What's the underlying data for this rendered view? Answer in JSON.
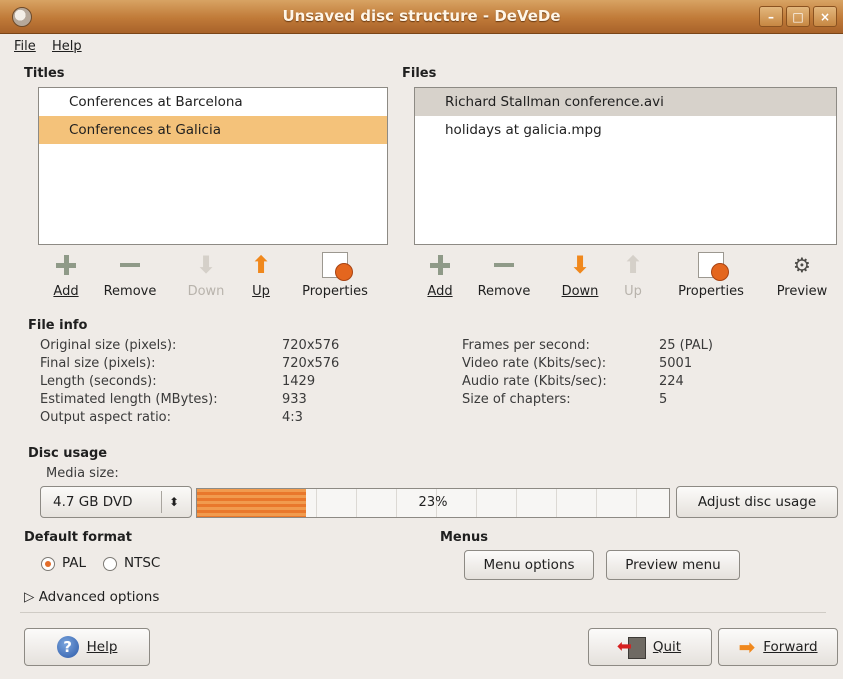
{
  "window": {
    "title": "Unsaved disc structure - DeVeDe",
    "controls": [
      "–",
      "□",
      "×"
    ]
  },
  "menubar": {
    "file": "File",
    "help": "Help"
  },
  "titles": {
    "label": "Titles",
    "items": [
      "Conferences at Barcelona",
      "Conferences at Galicia"
    ],
    "selected_index": 1,
    "toolbar": {
      "add": "Add",
      "remove": "Remove",
      "down": "Down",
      "up": "Up",
      "properties": "Properties"
    }
  },
  "files": {
    "label": "Files",
    "items": [
      "Richard Stallman conference.avi",
      "holidays at galicia.mpg"
    ],
    "selected_index": 0,
    "toolbar": {
      "add": "Add",
      "remove": "Remove",
      "down": "Down",
      "up": "Up",
      "properties": "Properties",
      "preview": "Preview"
    }
  },
  "file_info": {
    "label": "File info",
    "left": [
      {
        "label": "Original size (pixels):",
        "value": "720x576"
      },
      {
        "label": "Final size (pixels):",
        "value": "720x576"
      },
      {
        "label": "Length (seconds):",
        "value": "1429"
      },
      {
        "label": "Estimated length (MBytes):",
        "value": "933"
      },
      {
        "label": "Output aspect ratio:",
        "value": "4:3"
      }
    ],
    "right": [
      {
        "label": "Frames per second:",
        "value": "25 (PAL)"
      },
      {
        "label": "Video rate (Kbits/sec):",
        "value": "5001"
      },
      {
        "label": "Audio rate (Kbits/sec):",
        "value": "224"
      },
      {
        "label": "Size of chapters:",
        "value": "5"
      }
    ]
  },
  "disc_usage": {
    "label": "Disc usage",
    "media_label": "Media size:",
    "media_value": "4.7 GB DVD",
    "progress_text": "23%",
    "progress_fraction": 0.23,
    "adjust_button": "Adjust disc usage"
  },
  "default_format": {
    "label": "Default format",
    "pal": "PAL",
    "ntsc": "NTSC",
    "selected": "PAL"
  },
  "menus": {
    "label": "Menus",
    "options_button": "Menu options",
    "preview_button": "Preview menu"
  },
  "advanced": {
    "label": "Advanced options"
  },
  "footer": {
    "help": "Help",
    "quit": "Quit",
    "forward": "Forward"
  },
  "colors": {
    "accent": "#f0881d",
    "selection": "#f4c27a",
    "titlebar": "#c07a38"
  }
}
